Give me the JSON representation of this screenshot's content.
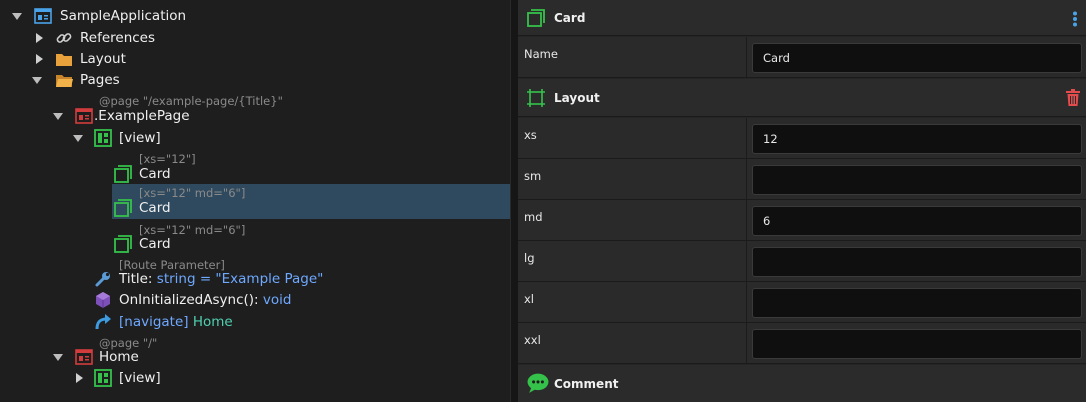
{
  "tree": {
    "app_name": "SampleApplication",
    "references": "References",
    "layout": "Layout",
    "pages": "Pages",
    "example_page_anno": "@page \"/example-page/{Title}\"",
    "example_page": ".ExamplePage",
    "view1": "[view]",
    "card1_anno": "[xs=\"12\"]",
    "card1": "Card",
    "card2_anno": "[xs=\"12\" md=\"6\"]",
    "card2": "Card",
    "card3_anno": "[xs=\"12\" md=\"6\"]",
    "card3": "Card",
    "route_anno": "[Route Parameter]",
    "title_name": "Title:",
    "title_type": "string = \"Example Page\"",
    "oninit_name": "OnInitializedAsync():",
    "oninit_type": "void",
    "navigate_tag": "[navigate]",
    "navigate_target": "Home",
    "home_anno": "@page \"/\"",
    "home": "Home",
    "view2": "[view]"
  },
  "props": {
    "header_title": "Card",
    "name_label": "Name",
    "name_value": "Card",
    "layout_title": "Layout",
    "rows": [
      {
        "label": "xs",
        "value": "12"
      },
      {
        "label": "sm",
        "value": ""
      },
      {
        "label": "md",
        "value": "6"
      },
      {
        "label": "lg",
        "value": ""
      },
      {
        "label": "xl",
        "value": ""
      },
      {
        "label": "xxl",
        "value": ""
      }
    ],
    "comment_title": "Comment"
  },
  "colors": {
    "selection": "#2f4a5e",
    "card_icon": "#35c24a",
    "page_icon": "#d23c3c",
    "folder_icon": "#e9a23b",
    "accent_blue": "#6ea8ff",
    "teal": "#4fd0b0",
    "delete_icon": "#e24c4c"
  }
}
